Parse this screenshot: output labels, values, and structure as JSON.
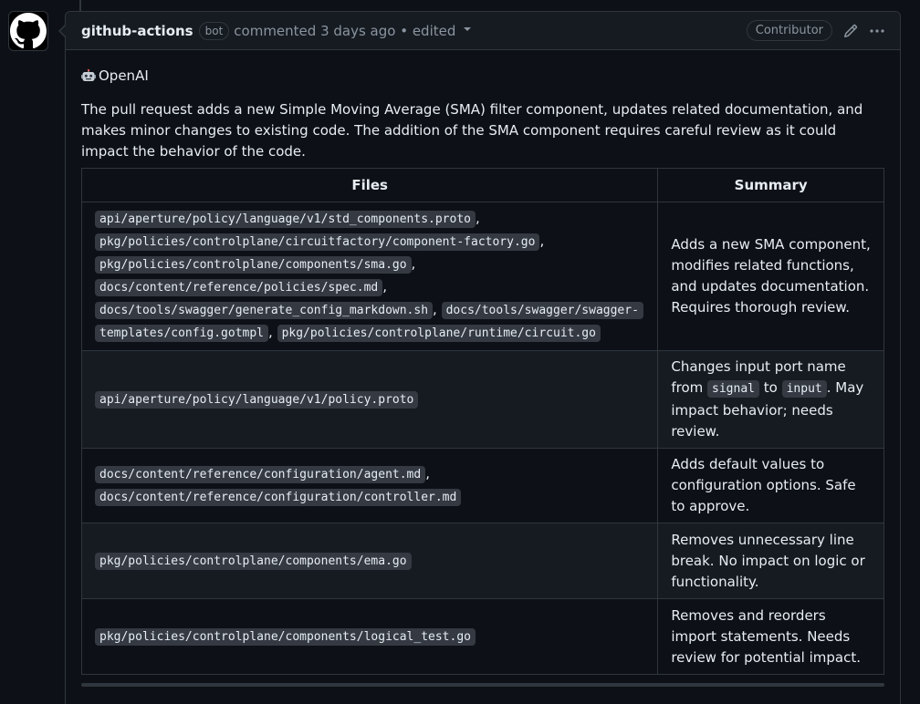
{
  "comment": {
    "author": "github-actions",
    "author_badge": "bot",
    "meta_text": "commented 3 days ago • edited",
    "role_badge": "Contributor",
    "icons": {
      "edit": "pencil-icon",
      "more": "kebab-horizontal-icon",
      "avatar": "github-logo-icon",
      "agent": "robot-emoji-icon"
    }
  },
  "body": {
    "agent_name": "OpenAI",
    "intro": "The pull request adds a new Simple Moving Average (SMA) filter component, updates related documentation, and makes minor changes to existing code. The addition of the SMA component requires careful review as it could impact the behavior of the code."
  },
  "table": {
    "headers": [
      "Files",
      "Summary"
    ],
    "rows": [
      {
        "files": [
          "api/aperture/policy/language/v1/std_components.proto",
          "pkg/policies/controlplane/circuitfactory/component-factory.go",
          "pkg/policies/controlplane/components/sma.go",
          "docs/content/reference/policies/spec.md",
          "docs/tools/swagger/generate_config_markdown.sh",
          "docs/tools/swagger/swagger-templates/config.gotmpl",
          "pkg/policies/controlplane/runtime/circuit.go"
        ],
        "summary_parts": [
          "Adds a new SMA component, modifies related functions, and updates documentation. Requires thorough review."
        ]
      },
      {
        "files": [
          "api/aperture/policy/language/v1/policy.proto"
        ],
        "summary_parts": [
          "Changes input port name from ",
          "signal",
          " to ",
          "input",
          ". May impact behavior; needs review."
        ]
      },
      {
        "files": [
          "docs/content/reference/configuration/agent.md",
          "docs/content/reference/configuration/controller.md"
        ],
        "summary_parts": [
          "Adds default values to configuration options. Safe to approve."
        ]
      },
      {
        "files": [
          "pkg/policies/controlplane/components/ema.go"
        ],
        "summary_parts": [
          "Removes unnecessary line break. No impact on logic or functionality."
        ]
      },
      {
        "files": [
          "pkg/policies/controlplane/components/logical_test.go"
        ],
        "summary_parts": [
          "Removes and reorders import statements. Needs review for potential impact."
        ]
      }
    ],
    "separator": ","
  },
  "colors": {
    "background": "#0d1117",
    "header_bg": "#161b22",
    "border": "#30363d",
    "text": "#e6edf3",
    "muted": "#8b949e",
    "code_bg": "#343942"
  }
}
